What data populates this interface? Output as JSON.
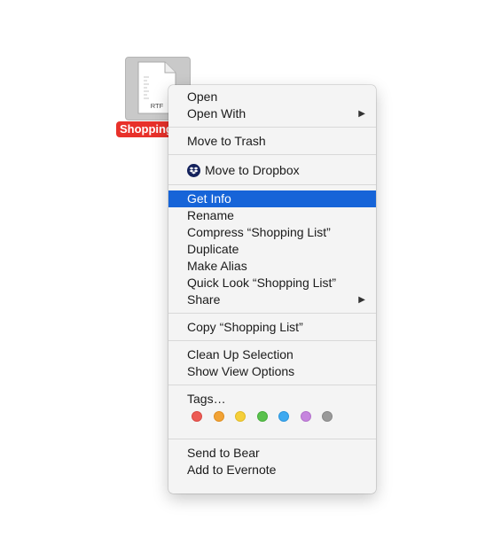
{
  "file": {
    "type_label": "RTF",
    "name": "Shopping"
  },
  "menu": {
    "open": "Open",
    "open_with": "Open With",
    "move_to_trash": "Move to Trash",
    "move_to_dropbox": "Move to Dropbox",
    "get_info": "Get Info",
    "rename": "Rename",
    "compress": "Compress “Shopping List”",
    "duplicate": "Duplicate",
    "make_alias": "Make Alias",
    "quick_look": "Quick Look “Shopping List”",
    "share": "Share",
    "copy": "Copy “Shopping List”",
    "clean_up": "Clean Up Selection",
    "show_view_options": "Show View Options",
    "tags": "Tags…",
    "send_to_bear": "Send to Bear",
    "add_to_evernote": "Add to Evernote",
    "submenu_arrow": "▶"
  },
  "tag_colors": [
    {
      "name": "red",
      "fill": "#ec5b55",
      "border": "#d84a44"
    },
    {
      "name": "orange",
      "fill": "#f1a235",
      "border": "#df8f22"
    },
    {
      "name": "yellow",
      "fill": "#f5cf3a",
      "border": "#e1bb28"
    },
    {
      "name": "green",
      "fill": "#5ac14d",
      "border": "#48ae3c"
    },
    {
      "name": "blue",
      "fill": "#3ea9f0",
      "border": "#2d96dc"
    },
    {
      "name": "purple",
      "fill": "#c685de",
      "border": "#b372cb"
    },
    {
      "name": "gray",
      "fill": "#9a9a9a",
      "border": "#888888"
    }
  ],
  "colors": {
    "highlight": "#1664d8",
    "file_label_bg": "#e8312a",
    "dropbox_badge": "#13215c"
  }
}
